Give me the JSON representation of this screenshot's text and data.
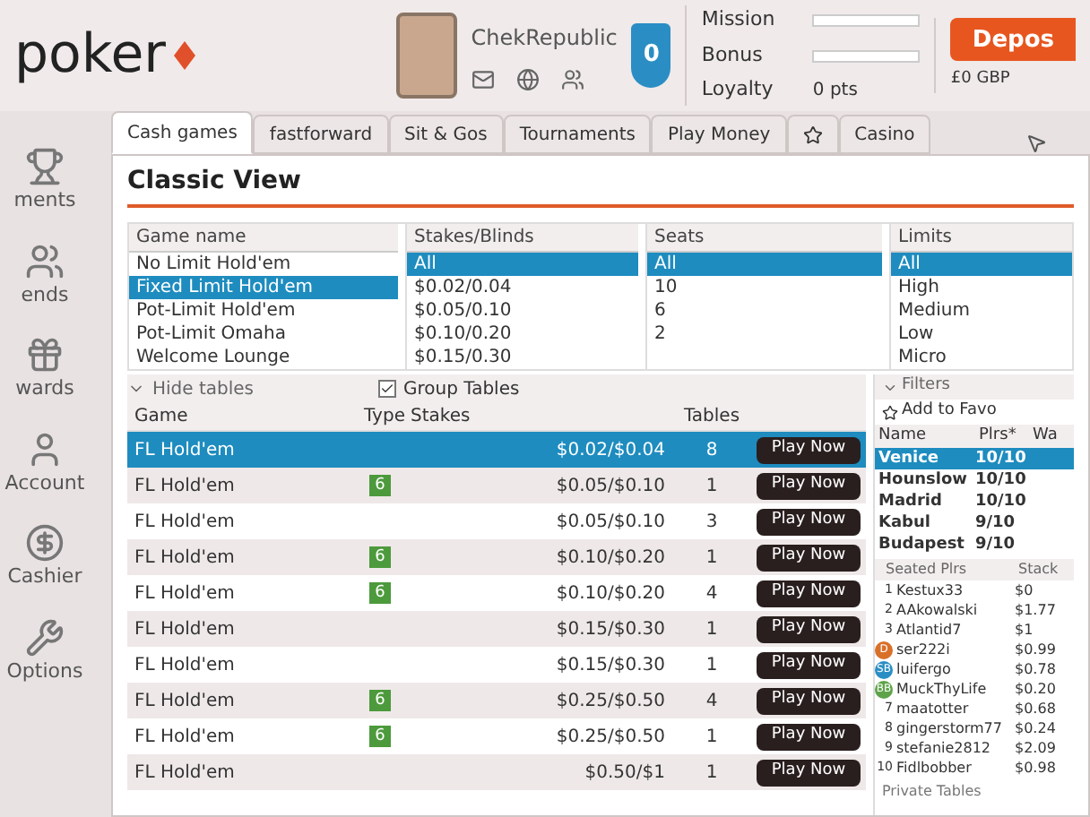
{
  "logo": {
    "text": "poker"
  },
  "sidebar": {
    "items": [
      {
        "label": "ments"
      },
      {
        "label": "ends"
      },
      {
        "label": "wards"
      },
      {
        "label": "Account"
      },
      {
        "label": "Cashier"
      },
      {
        "label": "Options"
      }
    ]
  },
  "account": {
    "username": "ChekRepublic",
    "shield": "0",
    "mission_label": "Mission",
    "bonus_label": "Bonus",
    "loyalty_label": "Loyalty",
    "loyalty_value": "0 pts",
    "deposit": "Depos",
    "balance": "£0 GBP"
  },
  "tabs": [
    {
      "label": "Cash games",
      "selected": true
    },
    {
      "label": "fastforward",
      "selected": false
    },
    {
      "label": "Sit & Gos",
      "selected": false
    },
    {
      "label": "Tournaments",
      "selected": false
    },
    {
      "label": "Play Money",
      "selected": false
    },
    {
      "kind": "star",
      "selected": false
    },
    {
      "label": "Casino",
      "selected": false
    }
  ],
  "title": "Classic View",
  "game_filter": {
    "header": "Game name",
    "items": [
      {
        "label": "No Limit Hold'em",
        "selected": false
      },
      {
        "label": "Fixed Limit Hold'em",
        "selected": true
      },
      {
        "label": "Pot-Limit Hold'em",
        "selected": false
      },
      {
        "label": "Pot-Limit Omaha",
        "selected": false
      },
      {
        "label": "Welcome Lounge",
        "selected": false
      }
    ]
  },
  "stakes_filter": {
    "header": "Stakes/Blinds",
    "items": [
      {
        "label": "All",
        "selected": true
      },
      {
        "label": "$0.02/0.04",
        "selected": false
      },
      {
        "label": "$0.05/0.10",
        "selected": false
      },
      {
        "label": "$0.10/0.20",
        "selected": false
      },
      {
        "label": "$0.15/0.30",
        "selected": false
      }
    ]
  },
  "seats_filter": {
    "header": "Seats",
    "items": [
      {
        "label": "All",
        "selected": true
      },
      {
        "label": "10",
        "selected": false
      },
      {
        "label": "6",
        "selected": false
      },
      {
        "label": "2",
        "selected": false
      }
    ]
  },
  "limits_filter": {
    "header": "Limits",
    "items": [
      {
        "label": "All",
        "selected": true
      },
      {
        "label": "High",
        "selected": false
      },
      {
        "label": "Medium",
        "selected": false
      },
      {
        "label": "Low",
        "selected": false
      },
      {
        "label": "Micro",
        "selected": false
      }
    ]
  },
  "hide_tables": "Hide tables",
  "group_tables": {
    "label": "Group Tables",
    "checked": true
  },
  "filters": "Filters",
  "add_favourite": "Add to Favo",
  "table": {
    "columns": [
      "Game",
      "Type",
      "Stakes",
      "Tables"
    ],
    "rows": [
      {
        "game": "FL Hold'em",
        "stakes": "$0.02/$0.04",
        "tables": "8",
        "button": "Play Now",
        "selected": true
      },
      {
        "game": "FL Hold'em",
        "type": "6",
        "stakes": "$0.05/$0.10",
        "tables": "1",
        "button": "Play Now",
        "selected": false
      },
      {
        "game": "FL Hold'em",
        "stakes": "$0.05/$0.10",
        "tables": "3",
        "button": "Play Now",
        "selected": false
      },
      {
        "game": "FL Hold'em",
        "type": "6",
        "stakes": "$0.10/$0.20",
        "tables": "1",
        "button": "Play Now",
        "selected": false
      },
      {
        "game": "FL Hold'em",
        "type": "6",
        "stakes": "$0.10/$0.20",
        "tables": "4",
        "button": "Play Now",
        "selected": false
      },
      {
        "game": "FL Hold'em",
        "stakes": "$0.15/$0.30",
        "tables": "1",
        "button": "Play Now",
        "selected": false
      },
      {
        "game": "FL Hold'em",
        "stakes": "$0.15/$0.30",
        "tables": "1",
        "button": "Play Now",
        "selected": false
      },
      {
        "game": "FL Hold'em",
        "type": "6",
        "stakes": "$0.25/$0.50",
        "tables": "4",
        "button": "Play Now",
        "selected": false
      },
      {
        "game": "FL Hold'em",
        "type": "6",
        "stakes": "$0.25/$0.50",
        "tables": "1",
        "button": "Play Now",
        "selected": false
      },
      {
        "game": "FL Hold'em",
        "stakes": "$0.50/$1",
        "tables": "1",
        "button": "Play Now",
        "selected": false
      }
    ]
  },
  "rooms": {
    "columns": [
      "Name",
      "Plrs*",
      "Wa"
    ],
    "rows": [
      {
        "name": "Venice",
        "players": "10/10",
        "selected": true
      },
      {
        "name": "Hounslow",
        "players": "10/10",
        "selected": false
      },
      {
        "name": "Madrid",
        "players": "10/10",
        "selected": false
      },
      {
        "name": "Kabul",
        "players": "9/10",
        "selected": false
      },
      {
        "name": "Budapest",
        "players": "9/10",
        "selected": false
      }
    ]
  },
  "seated": {
    "columns": [
      "Seated Plrs",
      "Stack"
    ],
    "rows": [
      {
        "seat": "1",
        "name": "Kestux33",
        "stack": "$0"
      },
      {
        "seat": "2",
        "name": "AAkowalski",
        "stack": "$1.77"
      },
      {
        "seat": "3",
        "name": "Atlantid7",
        "stack": "$1"
      },
      {
        "seat": "D",
        "kind": "dealer",
        "name": "ser222i",
        "stack": "$0.99"
      },
      {
        "seat": "SB",
        "kind": "small-blind",
        "name": "luifergo",
        "stack": "$0.78"
      },
      {
        "seat": "BB",
        "kind": "big-blind",
        "name": "MuckThyLife",
        "stack": "$0.20"
      },
      {
        "seat": "7",
        "name": "maatotter",
        "stack": "$0.68"
      },
      {
        "seat": "8",
        "name": "gingerstorm77",
        "stack": "$0.24"
      },
      {
        "seat": "9",
        "name": "stefanie2812",
        "stack": "$2.09"
      },
      {
        "seat": "10",
        "name": "Fidlbobber",
        "stack": "$0.98"
      }
    ]
  },
  "private_tables": "Private Tables"
}
